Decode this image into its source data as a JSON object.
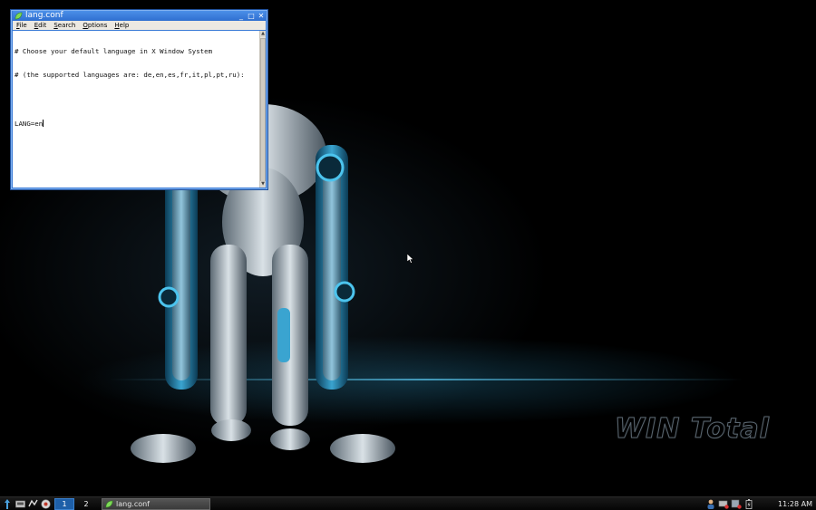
{
  "window": {
    "title": "lang.conf",
    "controls": {
      "minimize": "_",
      "maximize": "□",
      "close": "✕"
    }
  },
  "menu": [
    {
      "accel": "F",
      "rest": "ile"
    },
    {
      "accel": "E",
      "rest": "dit"
    },
    {
      "accel": "S",
      "rest": "earch"
    },
    {
      "accel": "O",
      "rest": "ptions"
    },
    {
      "accel": "H",
      "rest": "elp"
    }
  ],
  "document": {
    "lines": [
      "# Choose your default language in X Window System",
      "# (the supported languages are: de,en,es,fr,it,pl,pt,ru):",
      "",
      "LANG=en"
    ]
  },
  "desktop": {
    "watermark": "WIN Total"
  },
  "taskbar": {
    "workspaces": [
      "1",
      "2"
    ],
    "active_workspace": "1",
    "task_title": "lang.conf",
    "clock": "11:28 AM"
  },
  "icons": {
    "app": "leaf-icon",
    "launchers": [
      "menu-icon",
      "file-manager-icon",
      "network-icon",
      "browser-icon"
    ],
    "tray": [
      "user-icon",
      "network-status-icon",
      "volume-icon",
      "battery-icon"
    ]
  },
  "colors": {
    "titlebar": "#3b7bd6",
    "active_workspace": "#1e5fa8",
    "accent_glow": "#5ac8f0"
  }
}
